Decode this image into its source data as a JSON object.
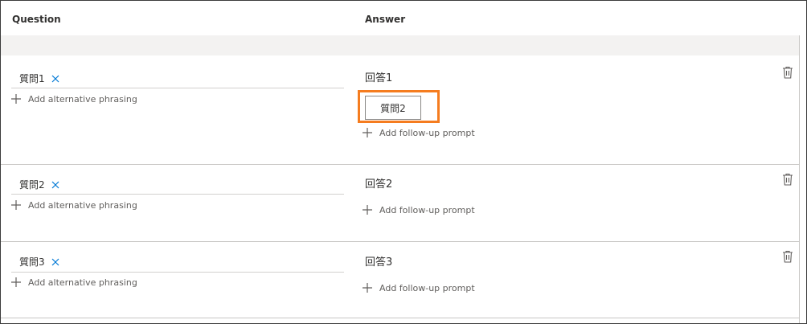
{
  "header": {
    "question_label": "Question",
    "answer_label": "Answer"
  },
  "rows": [
    {
      "question": "質問1",
      "add_alt_label": "Add alternative phrasing",
      "answer": "回答1",
      "prompts": [
        "質問2"
      ],
      "add_prompt_label": "Add follow-up prompt"
    },
    {
      "question": "質問2",
      "add_alt_label": "Add alternative phrasing",
      "answer": "回答2",
      "prompts": [],
      "add_prompt_label": "Add follow-up prompt"
    },
    {
      "question": "質問3",
      "add_alt_label": "Add alternative phrasing",
      "answer": "回答3",
      "prompts": [],
      "add_prompt_label": "Add follow-up prompt"
    }
  ],
  "icons": {
    "remove": "close-icon",
    "add": "plus-icon",
    "delete": "trash-icon"
  },
  "colors": {
    "highlight": "#f57c1f",
    "link_blue": "#0078d4",
    "band": "#f3f2f1"
  }
}
